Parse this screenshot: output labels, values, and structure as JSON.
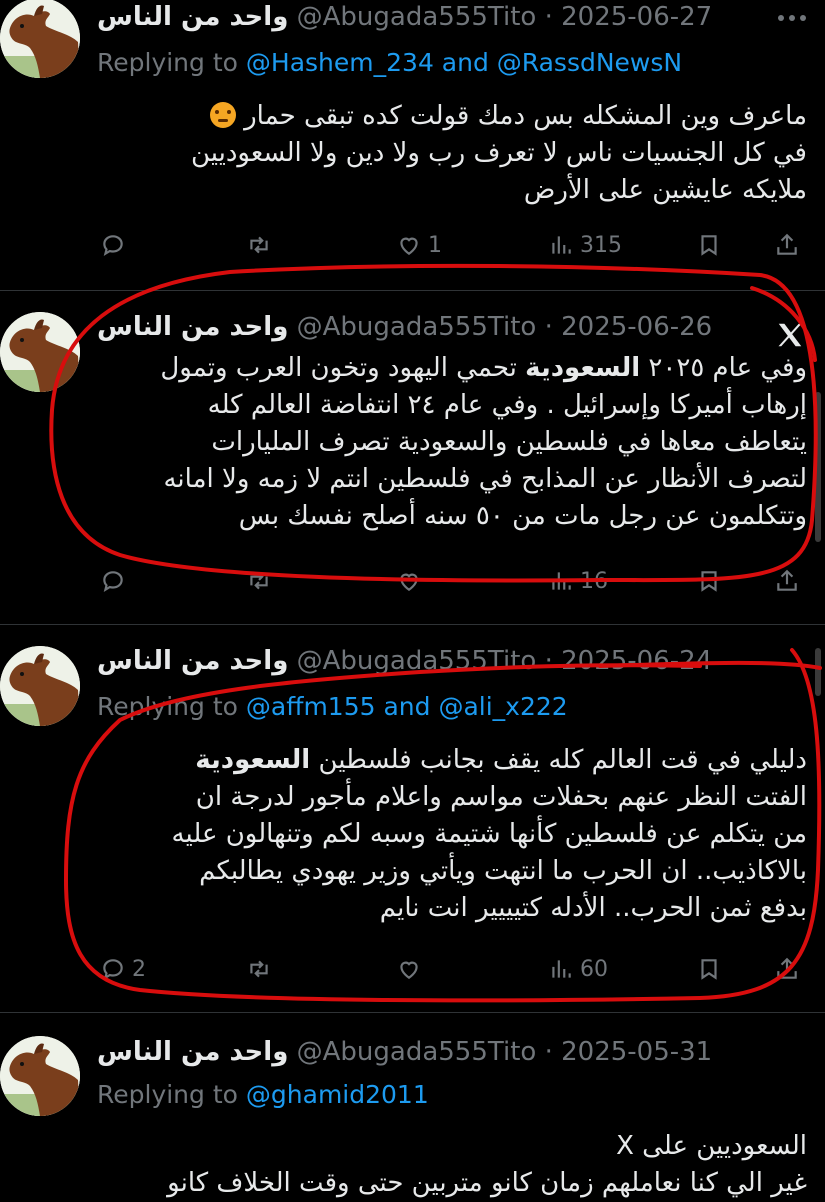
{
  "tweets": [
    {
      "name": "واحد من الناس",
      "handle": "@Abugada555Tito",
      "dot": "·",
      "date": "2025-06-27",
      "replying_prefix": "Replying to",
      "replying_mentions": "@Hashem_234 and @RassdNewsN",
      "lines": [
        "ماعرف وين المشكله بس دمك قولت كده تبقى حمار",
        "في كل الجنسيات ناس لا تعرف رب ولا دين ولا السعوديين",
        "ملايكه  عايشين على الأرض"
      ],
      "emoji": "angry-face-emoji",
      "reply_count": "",
      "retweet_count": "",
      "like_count": "1",
      "view_count": "315"
    },
    {
      "name": "واحد من الناس",
      "handle": "@Abugada555Tito",
      "dot": "·",
      "date": "2025-06-26",
      "lines": [
        "وفي عام ٢٠٢٥ السعودية تحمي اليهود وتخون العرب وتمول",
        "إرهاب أميركا وإسرائيل . وفي عام ٢٤ انتفاضة العالم كله",
        "يتعاطف معاها في فلسطين والسعودية تصرف المليارات",
        "لتصرف الأنظار عن المذابح في فلسطين انتم لا زمه ولا امانه",
        "وتتكلمون عن رجل مات من ٥٠ سنه أصلح نفسك بس"
      ],
      "line1_pre": "وفي عام ٢٠٢٥ ",
      "line1_bold": "السعودية",
      "line1_post": " تحمي اليهود وتخون العرب وتمول",
      "reply_count": "",
      "retweet_count": "",
      "like_count": "",
      "view_count": "16"
    },
    {
      "name": "واحد من الناس",
      "handle": "@Abugada555Tito",
      "dot": "·",
      "date": "2025-06-24",
      "replying_prefix": "Replying to",
      "replying_mentions": "@affm155 and @ali_x222",
      "lines": [
        "دليلي في قت العالم كله يقف بجانب فلسطين السعودية",
        "الفتت النظر عنهم بحفلات  مواسم واعلام مأجور لدرجة ان",
        "من يتكلم عن فلسطين  كأنها شتيمة وسبه لكم وتنهالون عليه",
        "بالاكاذيب.. ان الحرب ما انتهت ويأتي وزير يهودي يطالبكم",
        "بدفع ثمن الحرب.. الأدله كتيييير  انت نايم"
      ],
      "line1_pre": "دليلي في قت العالم كله يقف بجانب فلسطين ",
      "line1_bold": "السعودية",
      "reply_count": "2",
      "retweet_count": "",
      "like_count": "",
      "view_count": "60"
    },
    {
      "name": "واحد من الناس",
      "handle": "@Abugada555Tito",
      "dot": "·",
      "date": "2025-05-31",
      "replying_prefix": "Replying to",
      "replying_mentions": "@ghamid2011",
      "lines": [
        "السعوديين على X",
        "غير الي كنا نعاملهم زمان كانو متربين حتى وقت الخلاف كانو"
      ]
    }
  ],
  "colors": {
    "background": "#000000",
    "text": "#e7e9ea",
    "muted": "#71767b",
    "link": "#1d9bf0",
    "annotation": "#e00000"
  },
  "icons": [
    "reply-icon",
    "retweet-icon",
    "like-icon",
    "views-icon",
    "bookmark-icon",
    "share-icon",
    "x-logo-icon",
    "more-icon"
  ]
}
